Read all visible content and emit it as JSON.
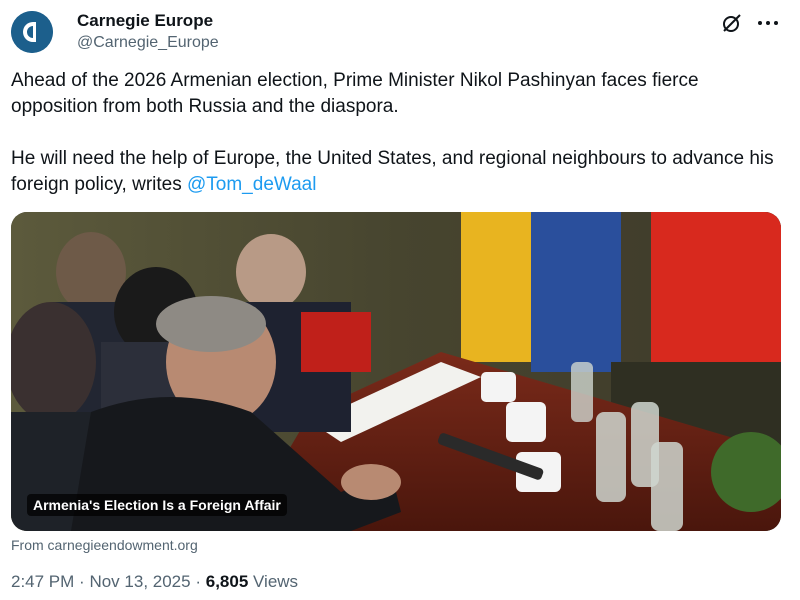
{
  "account": {
    "name": "Carnegie Europe",
    "handle": "@Carnegie_Europe",
    "avatar_icon": "carnegie-logo-icon",
    "avatar_color": "#1c5f8c"
  },
  "header_actions": {
    "grok_icon": "grok-icon",
    "more_icon": "more-icon"
  },
  "post": {
    "paragraph_1": "Ahead of the 2026 Armenian election, Prime Minister Nikol Pashinyan faces fierce opposition from both Russia and the diaspora.",
    "paragraph_2_text": "He will need the help of Europe, the United States, and regional neighbours to advance his foreign policy, writes ",
    "mention": "@Tom_deWaal",
    "mention_color": "#1d9bf0"
  },
  "card": {
    "title": "Armenia's Election Is a Foreign Affair",
    "source": "From carnegieendowment.org"
  },
  "meta": {
    "time": "2:47 PM",
    "separator": "·",
    "date": "Nov 13, 2025",
    "views_count": "6,805",
    "views_label": "Views"
  }
}
